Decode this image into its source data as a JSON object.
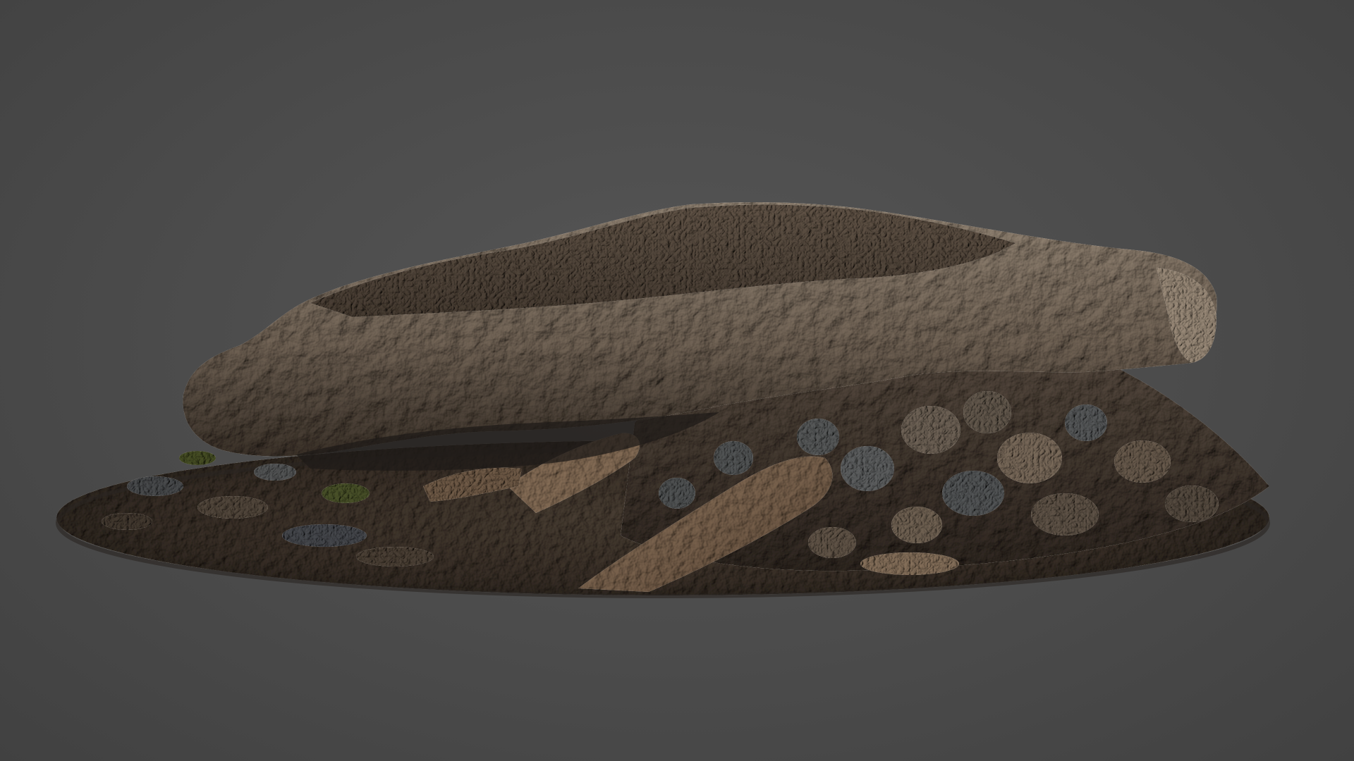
{
  "scene": {
    "background_color": "#4a4a4a",
    "subject": "photogrammetry-scan-rock-outcrop",
    "palette": {
      "ground_dark": "#2f2a26",
      "ground_mid": "#5a4f46",
      "rock_light": "#a59a8e",
      "rock_mid": "#7a6f64",
      "rock_dark": "#3c3631",
      "wood": "#9a826c",
      "moss": "#5f6e3a",
      "pebble_blue": "#6d7a86"
    }
  }
}
